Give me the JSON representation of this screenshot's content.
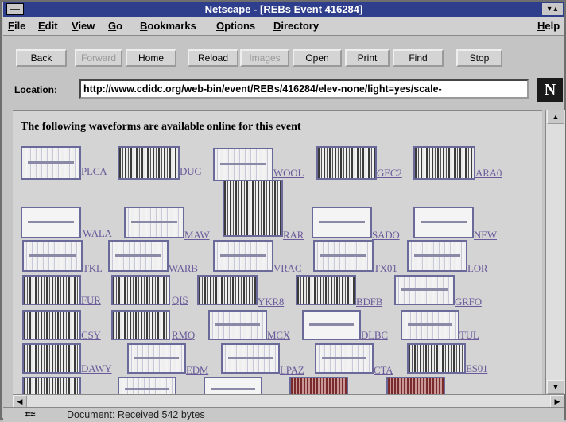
{
  "window": {
    "title": "Netscape - [REBs Event 416284]",
    "size_btns": "▾ ▴"
  },
  "menu": [
    {
      "ul": "F",
      "rest": "ile"
    },
    {
      "ul": "E",
      "rest": "dit"
    },
    {
      "ul": "V",
      "rest": "iew"
    },
    {
      "ul": "G",
      "rest": "o"
    },
    {
      "ul": "B",
      "rest": "ookmarks"
    },
    {
      "ul": "O",
      "rest": "ptions"
    },
    {
      "ul": "D",
      "rest": "irectory"
    },
    {
      "ul": "H",
      "rest": "elp"
    }
  ],
  "toolbar": {
    "back": "Back",
    "forward": "Forward",
    "home": "Home",
    "reload": "Reload",
    "images": "Images",
    "open": "Open",
    "print": "Print",
    "find": "Find",
    "stop": "Stop"
  },
  "location": {
    "label": "Location:",
    "url": "http://www.cdidc.org/web-bin/event/REBs/416284/elev-none/light=yes/scale-"
  },
  "logo": "N",
  "page": {
    "heading": "The following waveforms are available online for this event",
    "stations": [
      "PLCA",
      "DUG",
      "WOOL",
      "GEC2",
      "ARA0",
      "WALA",
      "MAW",
      "RAR",
      "SADO",
      "NEW",
      "TKL",
      "WARB",
      "VRAC",
      "TX01",
      "LOR",
      "FUR",
      "QIS",
      "YKR8",
      "BDFB",
      "GRFO",
      "CSY",
      "RMQ",
      "MCX",
      "DLBC",
      "TUL",
      "DAWY",
      "EDM",
      "LPAZ",
      "CTA",
      "ES01"
    ]
  },
  "status": {
    "icon": "⌗≈",
    "text": "Document: Received 542 bytes"
  }
}
